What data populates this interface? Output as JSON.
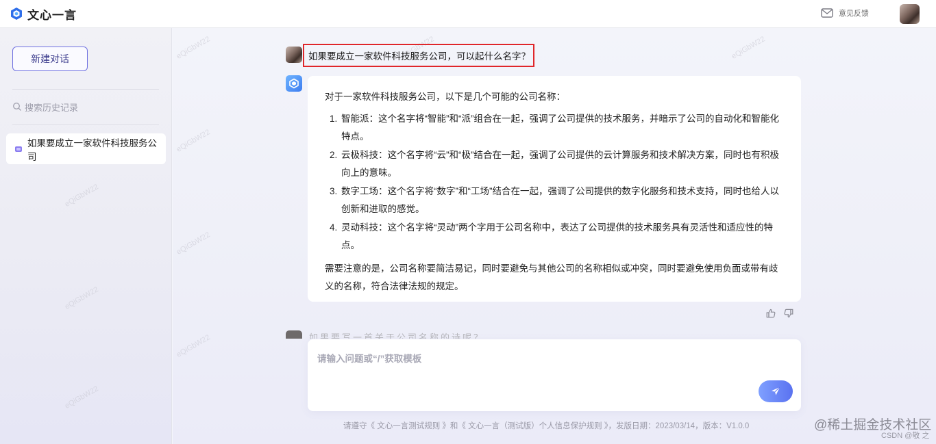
{
  "app": {
    "name": "文心一言",
    "feedback_label": "意见反馈"
  },
  "sidebar": {
    "new_chat_label": "新建对话",
    "search_placeholder": "搜索历史记录",
    "history": [
      {
        "title": "如果要成立一家软件科技服务公司"
      }
    ]
  },
  "conversation": {
    "question": "如果要成立一家软件科技服务公司，可以起什么名字？",
    "answer": {
      "intro": "对于一家软件科技服务公司，以下是几个可能的公司名称：",
      "items": [
        "智能派：这个名字将“智能”和“派”组合在一起，强调了公司提供的技术服务，并暗示了公司的自动化和智能化特点。",
        "云极科技：这个名字将“云”和“极”结合在一起，强调了公司提供的云计算服务和技术解决方案，同时也有积极向上的意味。",
        "数字工场：这个名字将“数字”和“工场”结合在一起，强调了公司提供的数字化服务和技术支持，同时也给人以创新和进取的感觉。",
        "灵动科技：这个名字将“灵动”两个字用于公司名称中，表达了公司提供的技术服务具有灵活性和适应性的特点。"
      ],
      "note": "需要注意的是，公司名称要简洁易记，同时要避免与其他公司的名称相似或冲突，同时要避免使用负面或带有歧义的名称，符合法律法规的规定。"
    },
    "next_question_partial": "如果要写一首关于公司名称的诗呢？"
  },
  "composer": {
    "placeholder": "请输入问题或“/”获取模板",
    "value": ""
  },
  "footer": {
    "text": "请遵守《 文心一言测试规则 》和《 文心一言（测试版）个人信息保护规则 》，发版日期：2023/03/14，版本：V1.0.0"
  },
  "overlay": {
    "site_mark": "@稀土掘金技术社区",
    "csdn_credit": "CSDN @敬 之",
    "watermark": "eQiGbW22"
  },
  "colors": {
    "accent": "#5a72f0",
    "highlight_border": "#e0262a",
    "brand_blue": "#3d7df0"
  }
}
